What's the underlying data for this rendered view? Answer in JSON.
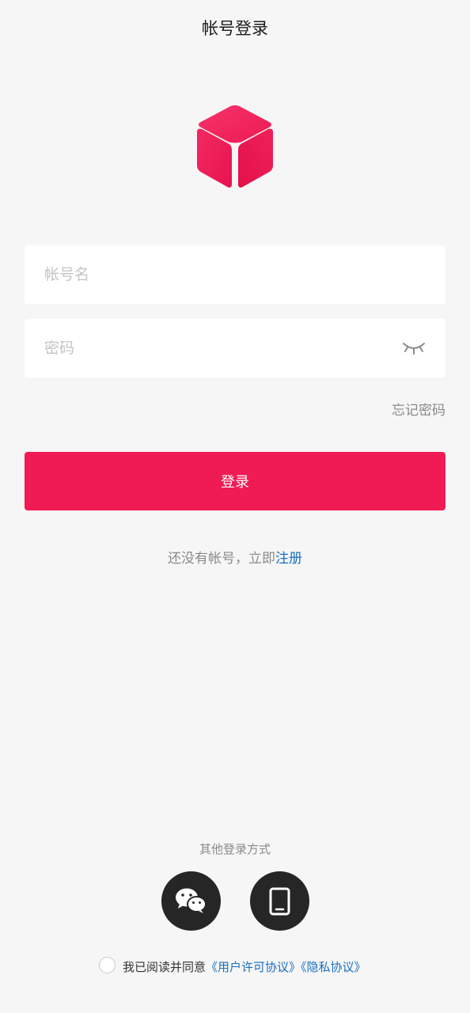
{
  "header": {
    "title": "帐号登录"
  },
  "form": {
    "account_placeholder": "帐号名",
    "password_placeholder": "密码",
    "forgot_label": "忘记密码",
    "login_label": "登录"
  },
  "register": {
    "prompt": "还没有帐号，立即",
    "link_label": "注册"
  },
  "other_login": {
    "title": "其他登录方式",
    "methods": [
      {
        "icon": "wechat-icon"
      },
      {
        "icon": "phone-icon"
      }
    ]
  },
  "agreement": {
    "checked": false,
    "text": "我已阅读并同意",
    "user_agreement": "《用户许可协议》",
    "privacy_agreement": "《隐私协议》"
  },
  "colors": {
    "accent": "#f01a54",
    "link": "#1a6fc0",
    "background": "#f6f6f6",
    "icon_button": "#262626"
  }
}
